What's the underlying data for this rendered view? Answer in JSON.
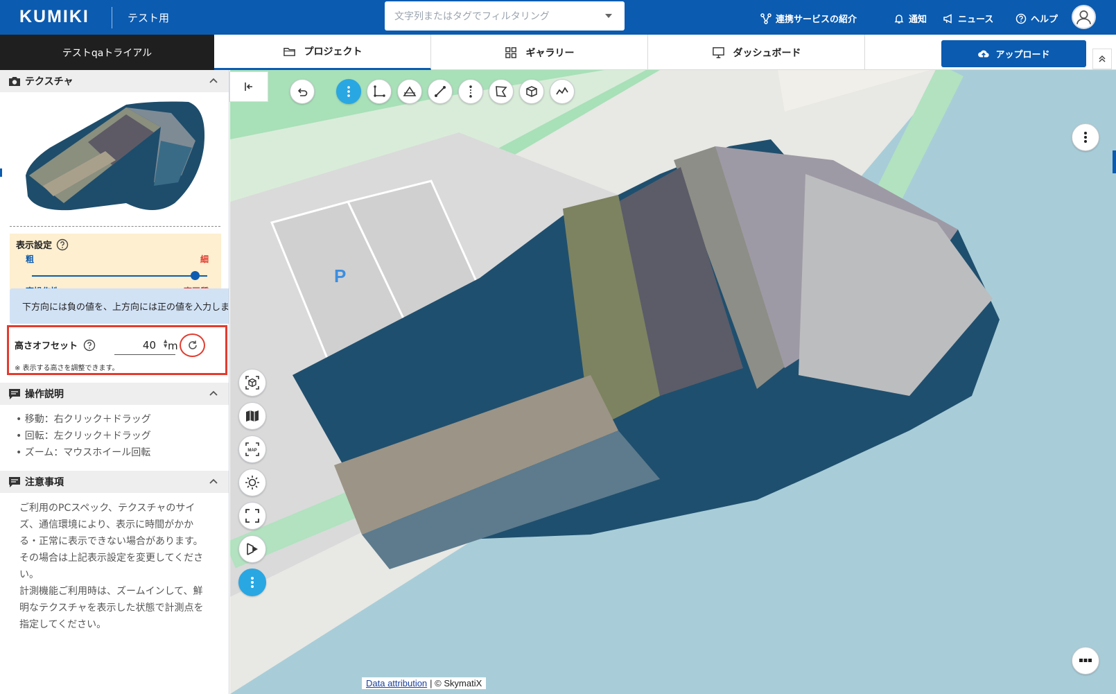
{
  "header": {
    "logo": "KUMIKI",
    "workspace": "テスト用",
    "filter_placeholder": "文字列またはタグでフィルタリング",
    "links": {
      "services": "連携サービスの紹介",
      "notifications": "通知",
      "news": "ニュース",
      "help": "ヘルプ"
    }
  },
  "tabbar": {
    "project_name": "テストqaトライアル",
    "tabs": {
      "project": "プロジェクト",
      "gallery": "ギャラリー",
      "dashboard": "ダッシュボード"
    },
    "upload": "アップロード"
  },
  "panel": {
    "texture": {
      "title": "テクスチャ"
    },
    "display": {
      "title": "表示設定",
      "coarse": "粗",
      "fine": "細",
      "performance": "高操作性",
      "quality": "高画質",
      "level": 0.93
    },
    "tooltip": "下方向には負の値を、上方向には正の値を入力します",
    "offset": {
      "label": "高さオフセット",
      "value": "40",
      "unit": "m",
      "note": "※ 表示する高さを調整できます。"
    },
    "operations": {
      "title": "操作説明",
      "items": [
        "移動：右クリック＋ドラッグ",
        "回転：左クリック＋ドラッグ",
        "ズーム：マウスホイール回転"
      ]
    },
    "notes": {
      "title": "注意事項",
      "paragraphs": [
        "ご利用のPCスペック、テクスチャのサイズ、通信環境により、表示に時間がかかる・正常に表示できない場合があります。その場合は上記表示設定を変更してください。",
        "計測機能ご利用時は、ズームインして、鮮明なテクスチャを表示した状態で計測点を指定してください。"
      ]
    }
  },
  "map": {
    "parking_label": "P",
    "attribution_link": "Data attribution",
    "attribution_text": "| © SkymatiX"
  },
  "colors": {
    "brand": "#0b5bb0",
    "accent": "#29a7e3",
    "highlight": "#e33b2e",
    "water": "#a8cdd8"
  }
}
